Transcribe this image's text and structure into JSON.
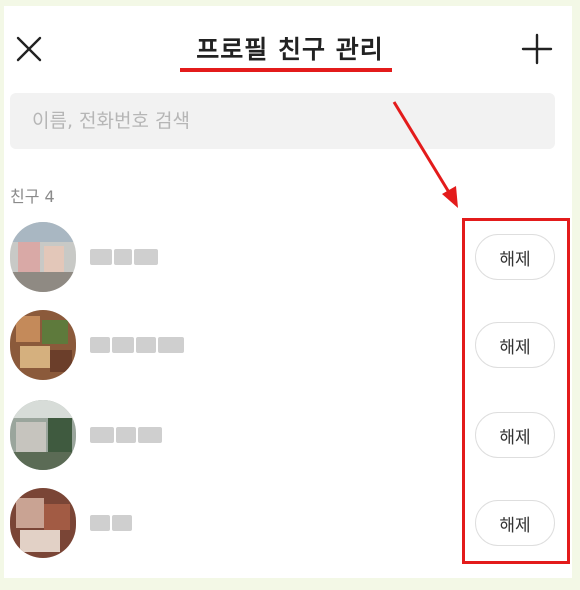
{
  "header": {
    "title": "프로필 친구 관리",
    "close_icon": "close-icon",
    "add_icon": "plus-icon"
  },
  "search": {
    "placeholder": "이름, 전화번호 검색"
  },
  "friends_section": {
    "label": "친구",
    "count": "4"
  },
  "friends": [
    {
      "release_label": "해제"
    },
    {
      "release_label": "해제"
    },
    {
      "release_label": "해제"
    },
    {
      "release_label": "해제"
    }
  ],
  "colors": {
    "annotation": "#e31b1b",
    "background": "#f3f8e6"
  }
}
